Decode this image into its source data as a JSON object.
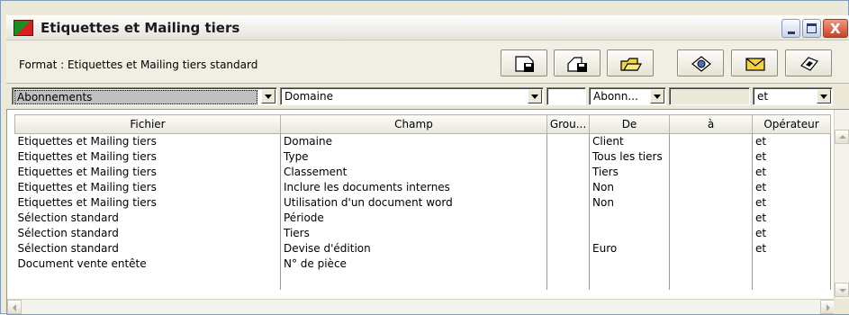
{
  "window": {
    "title": "Etiquettes et Mailing tiers",
    "close_glyph": "X"
  },
  "toolbar": {
    "format_label": "Format : Etiquettes et Mailing tiers standard",
    "buttons": [
      {
        "icon": "save-disk-icon"
      },
      {
        "icon": "save-as-icon"
      },
      {
        "icon": "open-folder-icon"
      },
      {
        "icon": "preview-icon"
      },
      {
        "icon": "mail-envelope-icon"
      },
      {
        "icon": "print-icon"
      }
    ]
  },
  "filters": {
    "fichier": "Abonnements",
    "champ": "Domaine",
    "groupe": "",
    "de": "Abonn...",
    "a": "",
    "operateur": "et"
  },
  "table": {
    "headers": [
      "Fichier",
      "Champ",
      "Grou...",
      "De",
      "à",
      "Opérateur"
    ],
    "rows": [
      [
        "Etiquettes et Mailing tiers",
        "Domaine",
        "",
        "Client",
        "",
        "et"
      ],
      [
        "Etiquettes et Mailing tiers",
        "Type",
        "",
        "Tous les tiers",
        "",
        "et"
      ],
      [
        "Etiquettes et Mailing tiers",
        "Classement",
        "",
        "Tiers",
        "",
        "et"
      ],
      [
        "Etiquettes et Mailing tiers",
        "Inclure les documents internes",
        "",
        "Non",
        "",
        "et"
      ],
      [
        "Etiquettes et Mailing tiers",
        "Utilisation d'un document word",
        "",
        "Non",
        "",
        "et"
      ],
      [
        "Sélection standard",
        "Période",
        "",
        "",
        "",
        "et"
      ],
      [
        "Sélection standard",
        "Tiers",
        "",
        "",
        "",
        "et"
      ],
      [
        "Sélection standard",
        "Devise d'édition",
        "",
        "Euro",
        "",
        "et"
      ],
      [
        "Document vente entête",
        "N° de pièce",
        "",
        "",
        "",
        ""
      ]
    ]
  },
  "colors": {
    "window_bg": "#ece9d8",
    "border": "#7f9db9",
    "close_button": "#c8412a"
  }
}
